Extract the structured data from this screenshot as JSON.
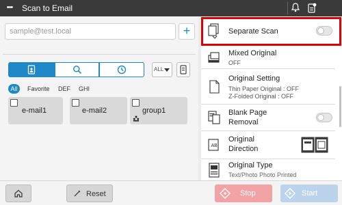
{
  "header": {
    "menu_label": "•••",
    "title": "Scan to Email",
    "notification_icon": "bell-icon",
    "status_icon": "device-status-icon"
  },
  "address": {
    "placeholder": "sample@test.local",
    "add_label": "+"
  },
  "view_tabs": [
    "address-book-icon",
    "search-icon",
    "history-icon"
  ],
  "sort_dropdown": {
    "value": "ALL"
  },
  "filters": [
    {
      "label": "All",
      "active": true
    },
    {
      "label": "Favorite",
      "active": false
    },
    {
      "label": "DEF",
      "active": false
    },
    {
      "label": "GHI",
      "active": false
    }
  ],
  "destinations": [
    {
      "label": "e-mail1",
      "type": "email"
    },
    {
      "label": "e-mail2",
      "type": "email"
    },
    {
      "label": "group1",
      "type": "group"
    }
  ],
  "options": {
    "separate_scan": {
      "label": "Separate Scan",
      "enabled": false
    },
    "mixed_original": {
      "label": "Mixed Original",
      "value": "OFF"
    },
    "original_setting": {
      "label": "Original Setting",
      "line1": "Thin Paper Original : OFF",
      "line2": "Z-Folded  Original : OFF"
    },
    "blank_page_removal": {
      "line1": "Blank Page",
      "line2": "Removal",
      "enabled": false
    },
    "original_direction": {
      "line1": "Original",
      "line2": "Direction"
    },
    "original_type": {
      "label": "Original Type",
      "value": "Text/Photo  Photo  Printed"
    }
  },
  "footer": {
    "home_icon": "home-icon",
    "reset_label": "Reset",
    "stop_label": "Stop",
    "start_label": "Start"
  },
  "colors": {
    "accent": "#1e88c8",
    "highlight": "#e00000",
    "stop": "#f2a3a6",
    "start": "#bcd3ec"
  }
}
